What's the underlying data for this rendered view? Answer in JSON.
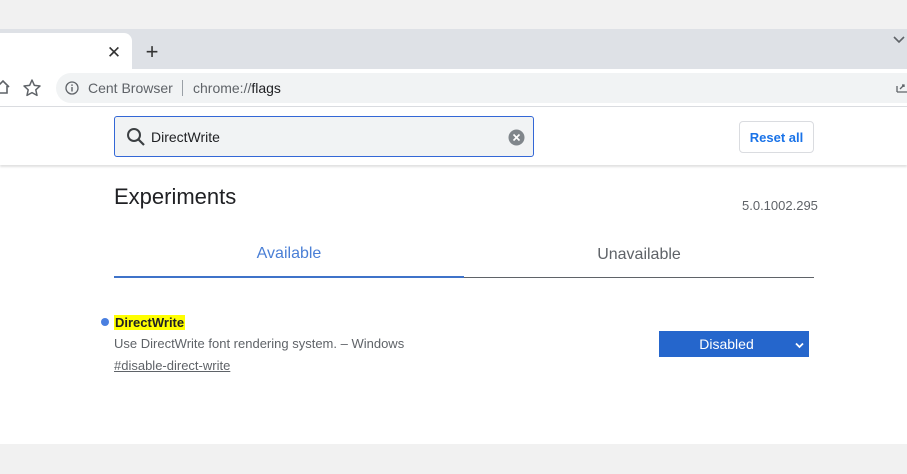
{
  "browser": {
    "new_tab_glyph": "+",
    "close_tab_glyph": "✕",
    "site_name": "Cent Browser",
    "url_scheme": "chrome://",
    "url_path": "flags"
  },
  "icons": {
    "home": "home-icon",
    "bookmark": "star-icon",
    "info": "info-icon",
    "tab_search": "chevron-down-icon",
    "search": "search-icon",
    "clear": "clear-icon",
    "select": "chevron-down-icon"
  },
  "search": {
    "value": "DirectWrite"
  },
  "header": {
    "reset_label": "Reset all"
  },
  "experiments": {
    "title": "Experiments",
    "version": "5.0.1002.295",
    "tabs": [
      {
        "label": "Available",
        "active": true
      },
      {
        "label": "Unavailable",
        "active": false
      }
    ],
    "flags": [
      {
        "name": "DirectWrite",
        "description": "Use DirectWrite font rendering system. – Windows",
        "link": "#disable-direct-write",
        "selected": "Disabled"
      }
    ]
  },
  "colors": {
    "accent": "#3367d6",
    "select_bg": "#2566cc",
    "highlight": "#ffff00",
    "tab_active": "#4a7fd6"
  }
}
